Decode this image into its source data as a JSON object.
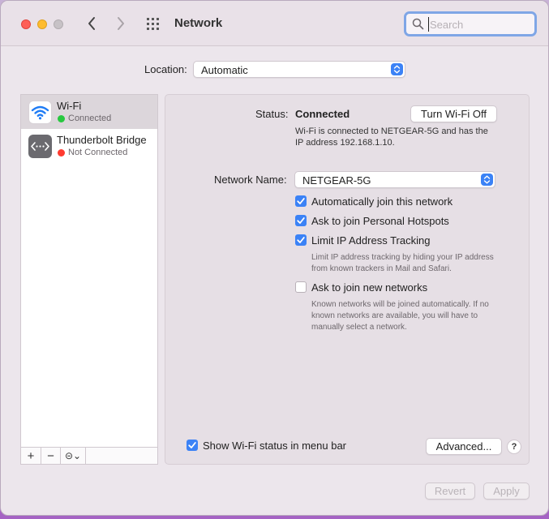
{
  "window": {
    "title": "Network",
    "search": {
      "placeholder": "Search",
      "value": ""
    }
  },
  "location": {
    "label": "Location:",
    "value": "Automatic"
  },
  "services": [
    {
      "name": "Wi-Fi",
      "status": "Connected",
      "status_color": "#28c840",
      "selected": true
    },
    {
      "name": "Thunderbolt Bridge",
      "status": "Not Connected",
      "status_color": "#ff3b30",
      "selected": false
    }
  ],
  "sidebar_toolbar": {
    "add": "+",
    "remove": "−",
    "action": "⊝⌄"
  },
  "detail": {
    "status_label": "Status:",
    "status_value": "Connected",
    "turn_off_button": "Turn Wi-Fi Off",
    "status_description": "Wi-Fi is connected to NETGEAR-5G and has the IP address 192.168.1.10.",
    "network_name_label": "Network Name:",
    "network_name_value": "NETGEAR-5G",
    "checkboxes": [
      {
        "label": "Automatically join this network",
        "checked": true
      },
      {
        "label": "Ask to join Personal Hotspots",
        "checked": true
      },
      {
        "label": "Limit IP Address Tracking",
        "checked": true
      },
      {
        "label": "Ask to join new networks",
        "checked": false
      }
    ],
    "limit_tracking_note": "Limit IP address tracking by hiding your IP address from known trackers in Mail and Safari.",
    "new_networks_note": "Known networks will be joined automatically. If no known networks are available, you will have to manually select a network.",
    "show_status_label": "Show Wi-Fi status in menu bar",
    "show_status_checked": true,
    "advanced_button": "Advanced...",
    "help_button": "?"
  },
  "footer": {
    "revert": "Revert",
    "apply": "Apply"
  },
  "colors": {
    "accent": "#3b82f6",
    "connected": "#28c840",
    "disconnected": "#ff3b30"
  }
}
